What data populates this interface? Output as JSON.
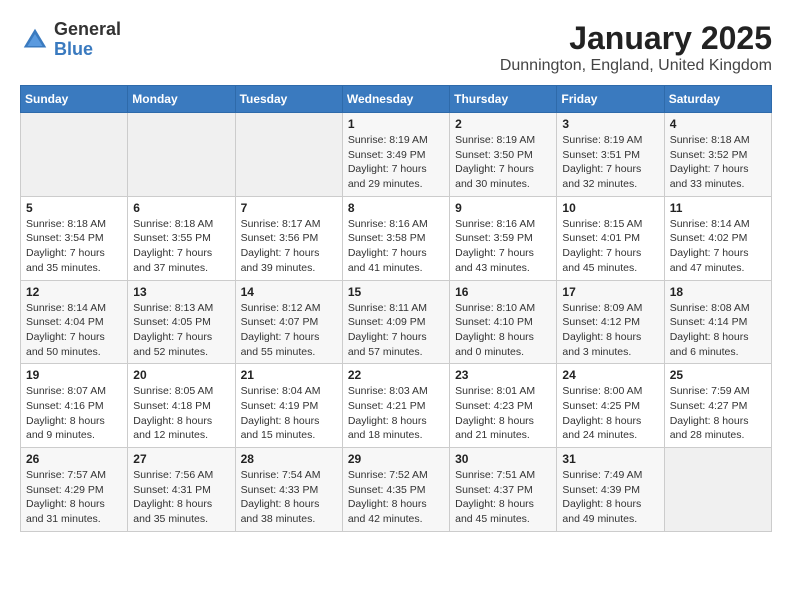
{
  "logo": {
    "general": "General",
    "blue": "Blue"
  },
  "title": "January 2025",
  "location": "Dunnington, England, United Kingdom",
  "weekdays": [
    "Sunday",
    "Monday",
    "Tuesday",
    "Wednesday",
    "Thursday",
    "Friday",
    "Saturday"
  ],
  "weeks": [
    [
      {
        "day": "",
        "info": ""
      },
      {
        "day": "",
        "info": ""
      },
      {
        "day": "",
        "info": ""
      },
      {
        "day": "1",
        "info": "Sunrise: 8:19 AM\nSunset: 3:49 PM\nDaylight: 7 hours\nand 29 minutes."
      },
      {
        "day": "2",
        "info": "Sunrise: 8:19 AM\nSunset: 3:50 PM\nDaylight: 7 hours\nand 30 minutes."
      },
      {
        "day": "3",
        "info": "Sunrise: 8:19 AM\nSunset: 3:51 PM\nDaylight: 7 hours\nand 32 minutes."
      },
      {
        "day": "4",
        "info": "Sunrise: 8:18 AM\nSunset: 3:52 PM\nDaylight: 7 hours\nand 33 minutes."
      }
    ],
    [
      {
        "day": "5",
        "info": "Sunrise: 8:18 AM\nSunset: 3:54 PM\nDaylight: 7 hours\nand 35 minutes."
      },
      {
        "day": "6",
        "info": "Sunrise: 8:18 AM\nSunset: 3:55 PM\nDaylight: 7 hours\nand 37 minutes."
      },
      {
        "day": "7",
        "info": "Sunrise: 8:17 AM\nSunset: 3:56 PM\nDaylight: 7 hours\nand 39 minutes."
      },
      {
        "day": "8",
        "info": "Sunrise: 8:16 AM\nSunset: 3:58 PM\nDaylight: 7 hours\nand 41 minutes."
      },
      {
        "day": "9",
        "info": "Sunrise: 8:16 AM\nSunset: 3:59 PM\nDaylight: 7 hours\nand 43 minutes."
      },
      {
        "day": "10",
        "info": "Sunrise: 8:15 AM\nSunset: 4:01 PM\nDaylight: 7 hours\nand 45 minutes."
      },
      {
        "day": "11",
        "info": "Sunrise: 8:14 AM\nSunset: 4:02 PM\nDaylight: 7 hours\nand 47 minutes."
      }
    ],
    [
      {
        "day": "12",
        "info": "Sunrise: 8:14 AM\nSunset: 4:04 PM\nDaylight: 7 hours\nand 50 minutes."
      },
      {
        "day": "13",
        "info": "Sunrise: 8:13 AM\nSunset: 4:05 PM\nDaylight: 7 hours\nand 52 minutes."
      },
      {
        "day": "14",
        "info": "Sunrise: 8:12 AM\nSunset: 4:07 PM\nDaylight: 7 hours\nand 55 minutes."
      },
      {
        "day": "15",
        "info": "Sunrise: 8:11 AM\nSunset: 4:09 PM\nDaylight: 7 hours\nand 57 minutes."
      },
      {
        "day": "16",
        "info": "Sunrise: 8:10 AM\nSunset: 4:10 PM\nDaylight: 8 hours\nand 0 minutes."
      },
      {
        "day": "17",
        "info": "Sunrise: 8:09 AM\nSunset: 4:12 PM\nDaylight: 8 hours\nand 3 minutes."
      },
      {
        "day": "18",
        "info": "Sunrise: 8:08 AM\nSunset: 4:14 PM\nDaylight: 8 hours\nand 6 minutes."
      }
    ],
    [
      {
        "day": "19",
        "info": "Sunrise: 8:07 AM\nSunset: 4:16 PM\nDaylight: 8 hours\nand 9 minutes."
      },
      {
        "day": "20",
        "info": "Sunrise: 8:05 AM\nSunset: 4:18 PM\nDaylight: 8 hours\nand 12 minutes."
      },
      {
        "day": "21",
        "info": "Sunrise: 8:04 AM\nSunset: 4:19 PM\nDaylight: 8 hours\nand 15 minutes."
      },
      {
        "day": "22",
        "info": "Sunrise: 8:03 AM\nSunset: 4:21 PM\nDaylight: 8 hours\nand 18 minutes."
      },
      {
        "day": "23",
        "info": "Sunrise: 8:01 AM\nSunset: 4:23 PM\nDaylight: 8 hours\nand 21 minutes."
      },
      {
        "day": "24",
        "info": "Sunrise: 8:00 AM\nSunset: 4:25 PM\nDaylight: 8 hours\nand 24 minutes."
      },
      {
        "day": "25",
        "info": "Sunrise: 7:59 AM\nSunset: 4:27 PM\nDaylight: 8 hours\nand 28 minutes."
      }
    ],
    [
      {
        "day": "26",
        "info": "Sunrise: 7:57 AM\nSunset: 4:29 PM\nDaylight: 8 hours\nand 31 minutes."
      },
      {
        "day": "27",
        "info": "Sunrise: 7:56 AM\nSunset: 4:31 PM\nDaylight: 8 hours\nand 35 minutes."
      },
      {
        "day": "28",
        "info": "Sunrise: 7:54 AM\nSunset: 4:33 PM\nDaylight: 8 hours\nand 38 minutes."
      },
      {
        "day": "29",
        "info": "Sunrise: 7:52 AM\nSunset: 4:35 PM\nDaylight: 8 hours\nand 42 minutes."
      },
      {
        "day": "30",
        "info": "Sunrise: 7:51 AM\nSunset: 4:37 PM\nDaylight: 8 hours\nand 45 minutes."
      },
      {
        "day": "31",
        "info": "Sunrise: 7:49 AM\nSunset: 4:39 PM\nDaylight: 8 hours\nand 49 minutes."
      },
      {
        "day": "",
        "info": ""
      }
    ]
  ]
}
